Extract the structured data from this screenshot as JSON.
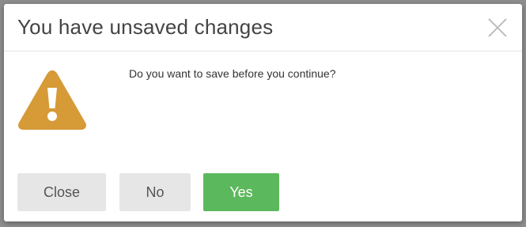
{
  "dialog": {
    "title": "You have unsaved changes",
    "message": "Do you want to save before you continue?",
    "close_icon": "close-x-icon",
    "warning_icon": "warning-triangle-icon"
  },
  "buttons": {
    "close_label": "Close",
    "no_label": "No",
    "yes_label": "Yes"
  },
  "colors": {
    "warning": "#d69a37",
    "yes_button": "#5cb85c",
    "secondary_button": "#e6e6e6"
  }
}
